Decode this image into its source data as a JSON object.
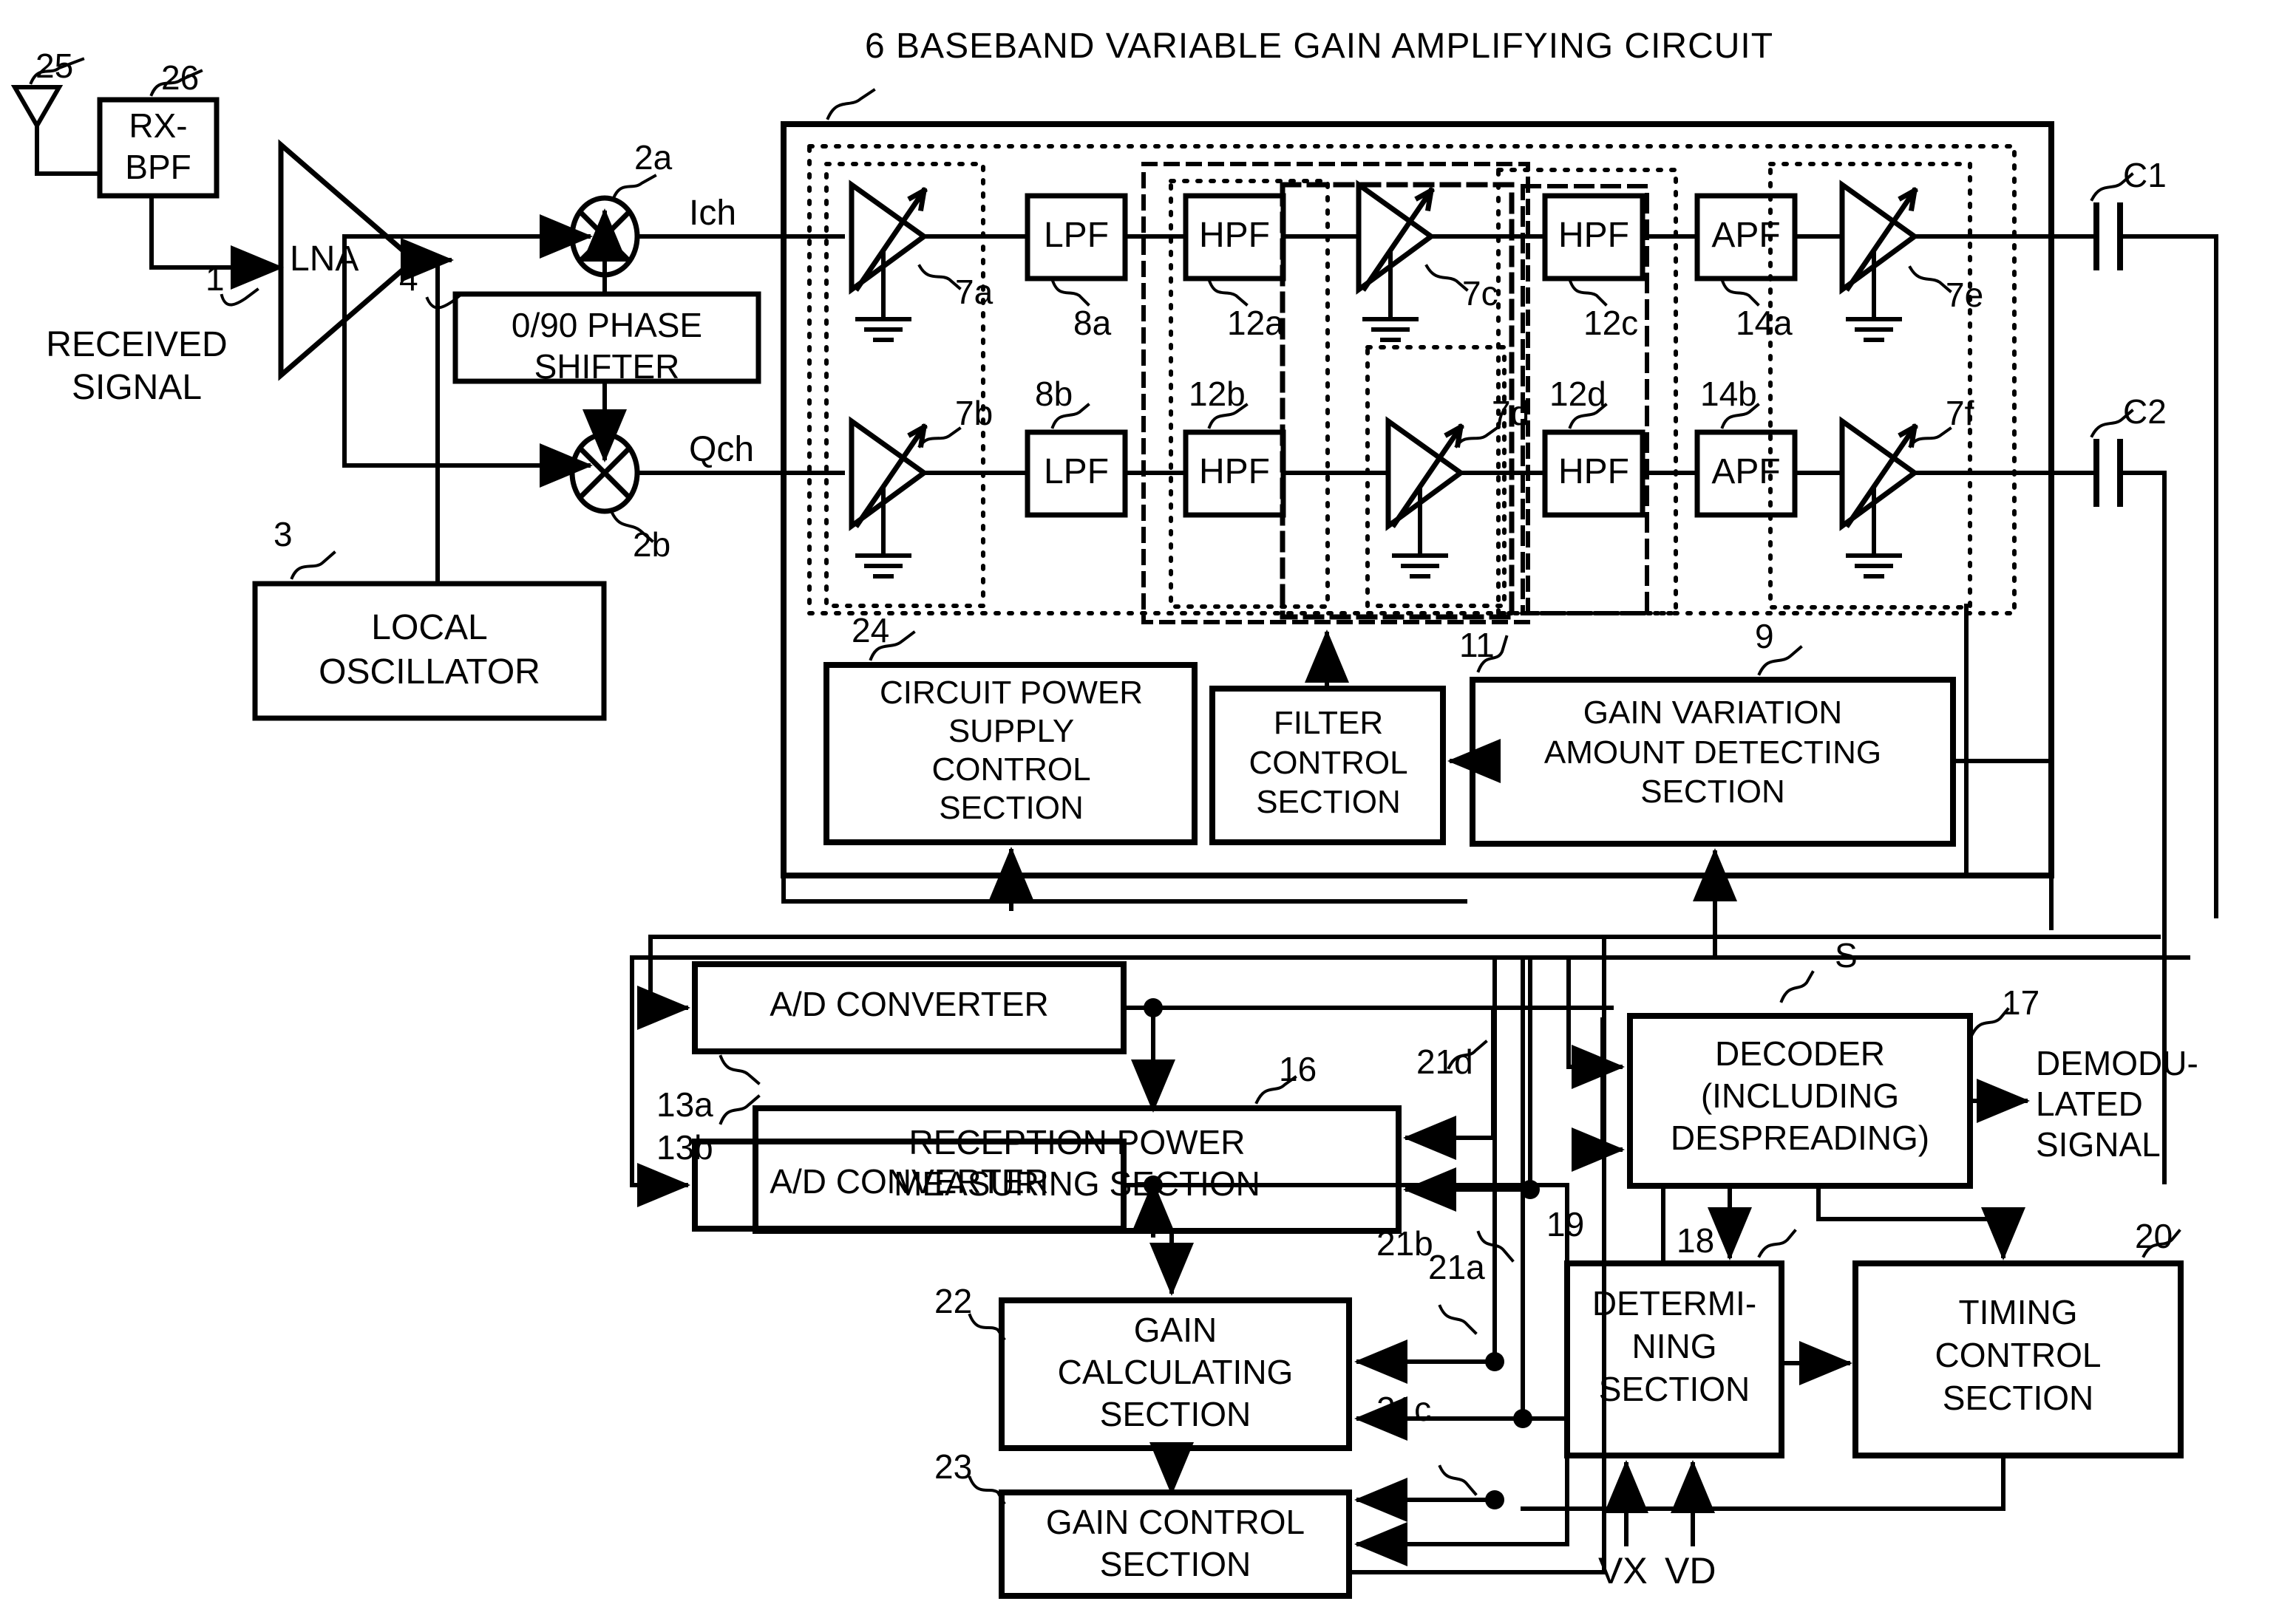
{
  "diagram": {
    "title": "6 BASEBAND VARIABLE GAIN AMPLIFYING CIRCUIT",
    "title_ref": "6",
    "title_text": "BASEBAND VARIABLE GAIN AMPLIFYING CIRCUIT"
  },
  "blocks": {
    "rx_bpf": "RX-\nBPF",
    "lna": "LNA",
    "phase_shifter": "0/90 PHASE\nSHIFTER",
    "local_oscillator": "LOCAL\nOSCILLATOR",
    "circuit_power_supply": "CIRCUIT POWER\nSUPPLY\nCONTROL\nSECTION",
    "filter_control": "FILTER\nCONTROL\nSECTION",
    "gain_variation": "GAIN VARIATION\nAMOUNT DETECTING\nSECTION",
    "ad_converter_1": "A/D CONVERTER",
    "ad_converter_2": "A/D CONVERTER",
    "reception_power": "RECEPTION POWER\nMEASURING SECTION",
    "decoder": "DECODER\n(INCLUDING\nDESPREADING)",
    "determining": "DETERMI-\nNING\nSECTION",
    "timing_control": "TIMING\nCONTROL\nSECTION",
    "gain_calculating": "GAIN\nCALCULATING\nSECTION",
    "gain_control": "GAIN CONTROL\nSECTION",
    "lpf_a": "LPF",
    "lpf_b": "LPF",
    "hpf_12a": "HPF",
    "hpf_12b": "HPF",
    "hpf_12c": "HPF",
    "hpf_12d": "HPF",
    "apf_14a": "APF",
    "apf_14b": "APF"
  },
  "signals": {
    "received_signal": "RECEIVED\nSIGNAL",
    "ich": "Ich",
    "qch": "Qch",
    "demodulated": "DEMODU-\nLATED\nSIGNAL",
    "vx": "VX",
    "vd": "VD"
  },
  "refs": {
    "antenna": "25",
    "rx_bpf": "26",
    "lna": "1",
    "phase_shifter": "4",
    "local_oscillator": "3",
    "mixer_i": "2a",
    "mixer_q": "2b",
    "vga_7a": "7a",
    "vga_7b": "7b",
    "vga_7c": "7c",
    "vga_7d": "7d",
    "vga_7e": "7e",
    "vga_7f": "7f",
    "lpf_8a": "8a",
    "lpf_8b": "8b",
    "hpf_12a": "12a",
    "hpf_12b": "12b",
    "hpf_12c": "12c",
    "hpf_12d": "12d",
    "apf_14a": "14a",
    "apf_14b": "14b",
    "cap_c1": "C1",
    "cap_c2": "C2",
    "circuit_power_supply": "24",
    "filter_control": "11",
    "gain_variation": "9",
    "ad_a": "13a",
    "ad_b": "13b",
    "reception_power": "16",
    "decoder": "17",
    "decoder_s": "S",
    "determining": "18",
    "timing_control": "20",
    "gain_calculating": "22",
    "gain_control": "23",
    "line_19": "19",
    "line_21a": "21a",
    "line_21b": "21b",
    "line_21c": "21c",
    "line_21d": "21d"
  },
  "colors": {
    "ink": "#000000",
    "paper": "#ffffff"
  }
}
